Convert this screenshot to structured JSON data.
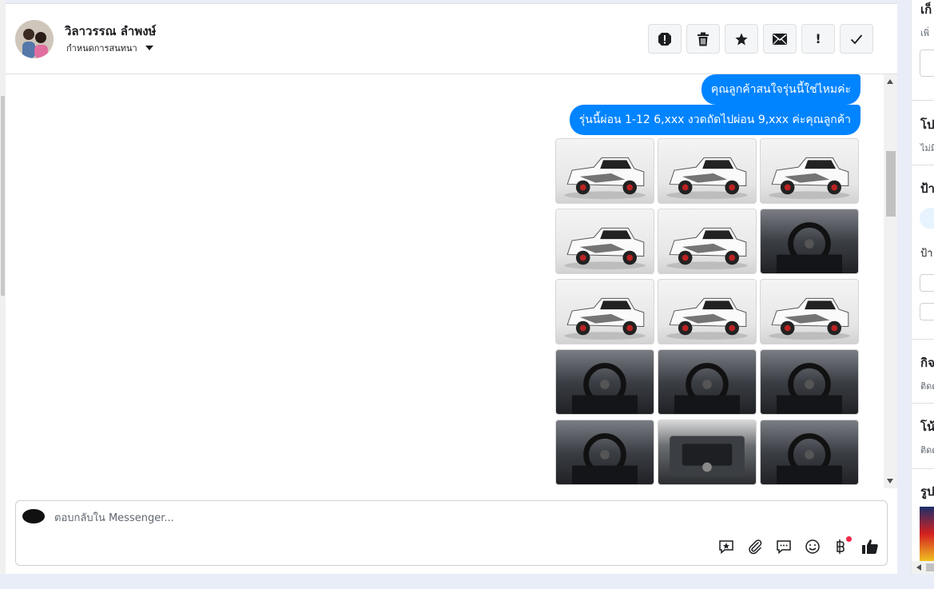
{
  "header": {
    "contact_name": "วิลาวรรณ ลำพงษ์",
    "assign_label": "กำหนดการสนทนา",
    "actions": [
      {
        "name": "report-icon",
        "glyph": "!"
      },
      {
        "name": "trash-icon",
        "glyph": "🗑"
      },
      {
        "name": "star-icon",
        "glyph": "★"
      },
      {
        "name": "mail-icon",
        "glyph": "✉"
      },
      {
        "name": "important-icon",
        "glyph": "!"
      },
      {
        "name": "check-icon",
        "glyph": "✓"
      }
    ]
  },
  "messages": [
    {
      "text": "คุณลูกค้าสนใจรุ่นนี้ใช่ไหมค่ะ"
    },
    {
      "text": "รุ่นนี้ผ่อน 1-12 6,xxx งวดถัดไปผ่อน 9,xxx ค่ะคุณลูกค้า"
    }
  ],
  "photos": [
    {
      "kind": "ext",
      "icon": "car-front-34-icon"
    },
    {
      "kind": "ext",
      "icon": "car-rear-34-icon"
    },
    {
      "kind": "ext",
      "icon": "car-rear-icon"
    },
    {
      "kind": "ext",
      "icon": "car-rear-34-icon"
    },
    {
      "kind": "ext",
      "icon": "car-side-icon"
    },
    {
      "kind": "int",
      "icon": "wheel-icon"
    },
    {
      "kind": "ext",
      "icon": "car-side-icon"
    },
    {
      "kind": "ext",
      "icon": "car-front-icon"
    },
    {
      "kind": "ext",
      "icon": "car-front-34-icon"
    },
    {
      "kind": "int",
      "icon": "dashboard-icon"
    },
    {
      "kind": "int",
      "icon": "seats-icon"
    },
    {
      "kind": "int",
      "icon": "steering-wheel-icon"
    },
    {
      "kind": "int",
      "icon": "gear-shift-icon"
    },
    {
      "kind": "eng",
      "icon": "engine-icon"
    },
    {
      "kind": "int",
      "icon": "gauges-icon"
    }
  ],
  "composer": {
    "placeholder": "ตอบกลับใน Messenger..."
  },
  "right_panel": {
    "sections": [
      {
        "title": "เก็",
        "sub": "เพิ่"
      },
      {
        "title": "โป",
        "sub": "ไม่มี"
      },
      {
        "title": "ป้า",
        "sub": "ป้า"
      },
      {
        "title": "กิจ",
        "sub": "ติดต"
      },
      {
        "title": "โน้",
        "sub": "ติดต"
      },
      {
        "title": "รูป",
        "sub": ""
      }
    ]
  },
  "colors": {
    "bubble": "#0084ff",
    "notification_dot": "#f02849"
  }
}
